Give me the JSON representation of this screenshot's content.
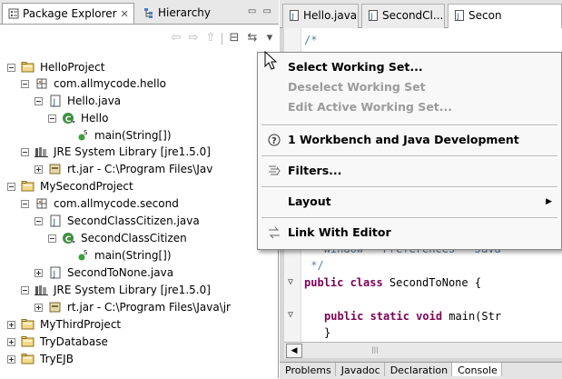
{
  "left_tabs": {
    "package_explorer": "Package Explorer",
    "hierarchy": "Hierarchy"
  },
  "tree": [
    {
      "label": "HelloProject",
      "icon": "project-folder-icon",
      "level": 0,
      "toggle": "minus"
    },
    {
      "label": "com.allmycode.hello",
      "icon": "package-icon",
      "level": 1,
      "toggle": "minus"
    },
    {
      "label": "Hello.java",
      "icon": "java-file-icon",
      "level": 2,
      "toggle": "minus"
    },
    {
      "label": "Hello",
      "icon": "class-icon",
      "level": 3,
      "toggle": "minus"
    },
    {
      "label": "main(String[])",
      "icon": "method-icon",
      "level": 4,
      "toggle": "none"
    },
    {
      "label": "JRE System Library [jre1.5.0]",
      "icon": "library-icon",
      "level": 1,
      "toggle": "minus"
    },
    {
      "label": "rt.jar - C:\\Program Files\\Jav",
      "icon": "jar-icon",
      "level": 2,
      "toggle": "plus"
    },
    {
      "label": "MySecondProject",
      "icon": "project-folder-icon",
      "level": 0,
      "toggle": "minus"
    },
    {
      "label": "com.allmycode.second",
      "icon": "package-icon",
      "level": 1,
      "toggle": "minus"
    },
    {
      "label": "SecondClassCitizen.java",
      "icon": "java-file-icon",
      "level": 2,
      "toggle": "minus"
    },
    {
      "label": "SecondClassCitizen",
      "icon": "class-icon",
      "level": 3,
      "toggle": "minus"
    },
    {
      "label": "main(String[])",
      "icon": "method-icon",
      "level": 4,
      "toggle": "none"
    },
    {
      "label": "SecondToNone.java",
      "icon": "java-file-icon",
      "level": 2,
      "toggle": "plus"
    },
    {
      "label": "JRE System Library [jre1.5.0]",
      "icon": "library-icon",
      "level": 1,
      "toggle": "minus"
    },
    {
      "label": "rt.jar - C:\\Program Files\\Java\\jr",
      "icon": "jar-icon",
      "level": 2,
      "toggle": "plus"
    },
    {
      "label": "MyThirdProject",
      "icon": "project-folder-icon",
      "level": 0,
      "toggle": "plus"
    },
    {
      "label": "TryDatabase",
      "icon": "project-folder-icon",
      "level": 0,
      "toggle": "plus"
    },
    {
      "label": "TryEJB",
      "icon": "project-folder-icon",
      "level": 0,
      "toggle": "plus"
    }
  ],
  "editor_tabs": [
    "Hello.java",
    "SecondCl...",
    "Secon"
  ],
  "code_lines": {
    "l1": "/*",
    "l2": " * Window - Preferences - Java",
    "l3": " */",
    "l4_kw": "public class",
    "l4_rest": " SecondToNone {",
    "l5_kw": "public static void",
    "l5_rest": " main(Str",
    "l6": "}"
  },
  "bottom_tabs": [
    "Problems",
    "Javadoc",
    "Declaration",
    "Console"
  ],
  "menu": {
    "select_working_set": "Select Working Set...",
    "deselect_working_set": "Deselect Working Set",
    "edit_active_working_set": "Edit Active Working Set...",
    "workbench": "1 Workbench and Java Development",
    "filters": "Filters...",
    "layout": "Layout",
    "link_with_editor": "Link With Editor"
  },
  "colors": {
    "keyword": "#7f0055",
    "comment": "#5f7f9f",
    "disabled": "#9b9b9b"
  }
}
